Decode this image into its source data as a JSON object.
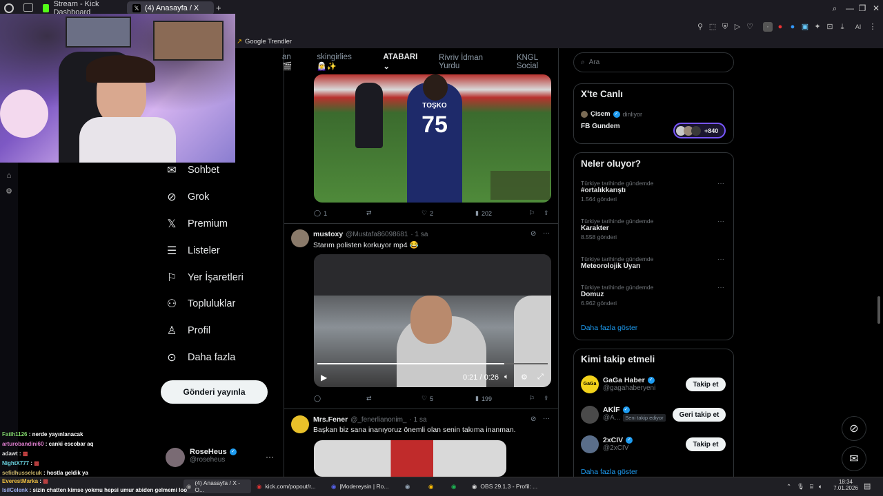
{
  "browser": {
    "tabs": [
      {
        "label": "Stream - Kick Dashboard"
      },
      {
        "label": "(4) Anasayfa / X"
      }
    ],
    "bookmark": "Google Trendler"
  },
  "nav": {
    "items": [
      {
        "label": "Sohbet"
      },
      {
        "label": "Grok"
      },
      {
        "label": "Premium"
      },
      {
        "label": "Listeler"
      },
      {
        "label": "Yer İşaretleri"
      },
      {
        "label": "Topluluklar"
      },
      {
        "label": "Profil"
      },
      {
        "label": "Daha fazla"
      }
    ],
    "post_button": "Gönderi yayınla",
    "account": {
      "name": "RoseHeus",
      "handle": "@roseheus"
    }
  },
  "topnav": {
    "tabs": [
      {
        "label": "an 🎬"
      },
      {
        "label": "skingirlies🧝‍♀️✨"
      },
      {
        "label": "ATABARI"
      },
      {
        "label": "Rivriv İdman Yurdu"
      },
      {
        "label": "KNGL Social"
      }
    ],
    "active": "ATABARI"
  },
  "feed": {
    "post1": {
      "jersey_name": "TOŞKO",
      "jersey_number": "75",
      "replies": "1",
      "likes": "2",
      "views": "202"
    },
    "post2": {
      "name": "mustoxy",
      "handle": "@Mustafa86098681",
      "time": "· 1 sa",
      "text": "Starım polisten korkuyor mp4 😂",
      "video_time": "0:21 / 0:26",
      "video_progress": 0.81,
      "likes": "5",
      "views": "199"
    },
    "post3": {
      "name": "Mrs.Fener",
      "handle": "@_fenerlianonim_",
      "time": "· 1 sa",
      "text": "Başkan biz sana inanıyoruz önemli olan senin takıma inanman."
    }
  },
  "right": {
    "search_placeholder": "Ara",
    "live": {
      "title": "X'te Canlı",
      "host": "Çisem",
      "host_status": "dinliyor",
      "space": "FB Gundem",
      "listeners": "+840"
    },
    "trends": {
      "title": "Neler oluyor?",
      "items": [
        {
          "context": "Türkiye tarihinde gündemde",
          "name": "#ortalıkkarıştı",
          "count": "1.564 gönderi"
        },
        {
          "context": "Türkiye tarihinde gündemde",
          "name": "Karakter",
          "count": "8.558 gönderi"
        },
        {
          "context": "Türkiye tarihinde gündemde",
          "name": "Meteorolojik Uyarı",
          "count": ""
        },
        {
          "context": "Türkiye tarihinde gündemde",
          "name": "Domuz",
          "count": "6.962 gönderi"
        }
      ],
      "more": "Daha fazla göster"
    },
    "follow": {
      "title": "Kimi takip etmeli",
      "users": [
        {
          "name": "GaGa Haber",
          "handle": "@gagahaberyeni",
          "button": "Takip et",
          "badge": ""
        },
        {
          "name": "AKİF",
          "handle": "@A...",
          "button": "Geri takip et",
          "badge": "Seni takip ediyor"
        },
        {
          "name": "2xCIV",
          "handle": "@2xCIV",
          "button": "Takip et",
          "badge": ""
        }
      ],
      "more": "Daha fazla göster"
    }
  },
  "chat": [
    {
      "user": "Fatih1126",
      "msg": ": nerde yayınlanacak",
      "color": "#7fd36a"
    },
    {
      "user": "arturobandini60",
      "msg": ": canki escobar aq",
      "color": "#e07fd0"
    },
    {
      "user": "adawt",
      "msg": ":",
      "color": "#e0e0e0"
    },
    {
      "user": "NightX777",
      "msg": ":",
      "color": "#6ad3e0"
    },
    {
      "user": "sefidhusselcuk",
      "msg": ": hostla geldik ya",
      "color": "#c8b46a"
    },
    {
      "user": "EverestMarka",
      "msg": ":",
      "color": "#f0c040"
    },
    {
      "user": "lsilCelenk",
      "msg": ": sizin chatten kimse yokmu hepsi umur abiden gelmemi loo",
      "color": "#9fb0f0"
    }
  ],
  "taskbar": {
    "items": [
      {
        "label": "(4) Anasayfa / X - O..."
      },
      {
        "label": "kick.com/popout/r..."
      },
      {
        "label": "|Modereysin | Ro..."
      },
      {
        "label": "OBS 29.1.3 - Profil: ..."
      }
    ],
    "time": "18:34",
    "date": "7.01.2026"
  }
}
